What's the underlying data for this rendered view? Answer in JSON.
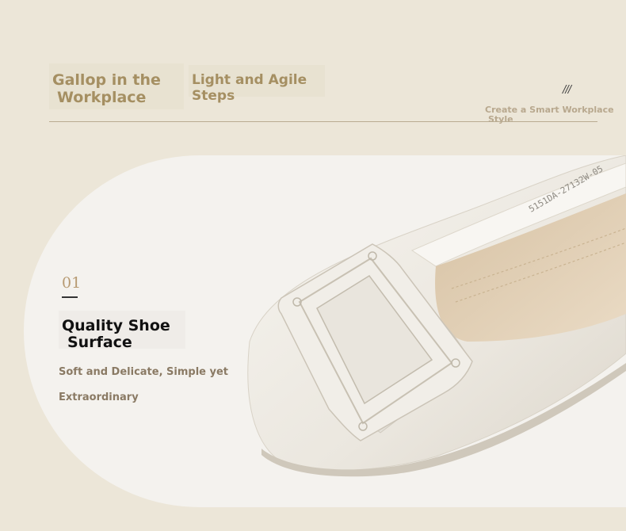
{
  "header": {
    "tagline_left": {
      "line1": "Gallop in the",
      "line2": "Workplace"
    },
    "tagline_middle": "Light and Agile Steps",
    "slashes": "///",
    "tagline_right": {
      "line1": "Create a Smart Workplace",
      "line2": "Style"
    }
  },
  "feature": {
    "number": "01",
    "title": {
      "line1": "Quality Shoe",
      "line2": "Surface"
    },
    "description": {
      "line1": "Soft and Delicate, Simple yet",
      "line2": "Extraordinary"
    }
  },
  "product": {
    "shoe_code": "5151DA-27132W-05",
    "colors": {
      "background": "#ece6d8",
      "panel": "#f4f2ee",
      "leather": "#ebe7df",
      "insole": "#e0cfb6",
      "accent": "#a58f62"
    }
  }
}
